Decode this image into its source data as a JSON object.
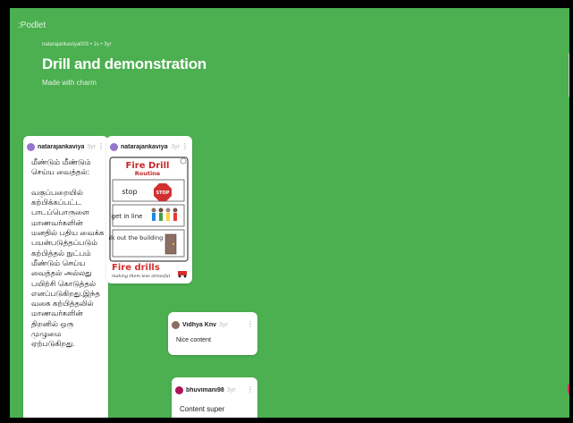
{
  "brand": ":Podlet",
  "header": {
    "meta": "natarajankaviya003 • 1s • 3yr",
    "title": "Drill and demonstration",
    "subtitle": "Made with charm"
  },
  "posts": [
    {
      "author": "natarajankaviya0...",
      "age": "3yr",
      "avatar_color": "#9575cd",
      "body": "மீண்டும் மீண்டும்\nசெய்ய வைத்தல்:\n\nவகுப்பறையில்\nகற்பிக்கப்பட்ட\nபாடப்பொருளை\nமாணவர்களின்\nமனதில் பதிய வைக்க\nபயன்படுத்தப்படும்\nகற்பித்தல் நுட்பம்\nமீண்டும் செய்ய\nவைத்தல் அல்லது\nபயிற்சி கொடுத்தல்\nஎனப்படுகிறது.இந்த\nவகை கற்பித்தலில்\nமாணவர்களின்\nதிறனில் ஒரு முழுமை\nஏற்படுகிறது."
    },
    {
      "author": "natarajankaviya0...",
      "age": "3yr",
      "avatar_color": "#9575cd",
      "image": {
        "heading1": "Fire Drill",
        "heading2": "Routine",
        "steps": [
          "stop",
          "get in line",
          "walk out the building"
        ],
        "stop_sign": "STOP",
        "footer": "Fire drills",
        "tagline": "making them less stressful"
      }
    }
  ],
  "comments": [
    {
      "author": "Vidhya Knv",
      "age": "3yr",
      "avatar_color": "#8d6e63",
      "text": "Nice content"
    },
    {
      "author": "bhuvimani98",
      "age": "3yr",
      "avatar_color": "#ad1457",
      "text": "Content super"
    }
  ],
  "colors": {
    "background": "#4caf50",
    "card": "#ffffff",
    "fab": "#e91e63"
  }
}
